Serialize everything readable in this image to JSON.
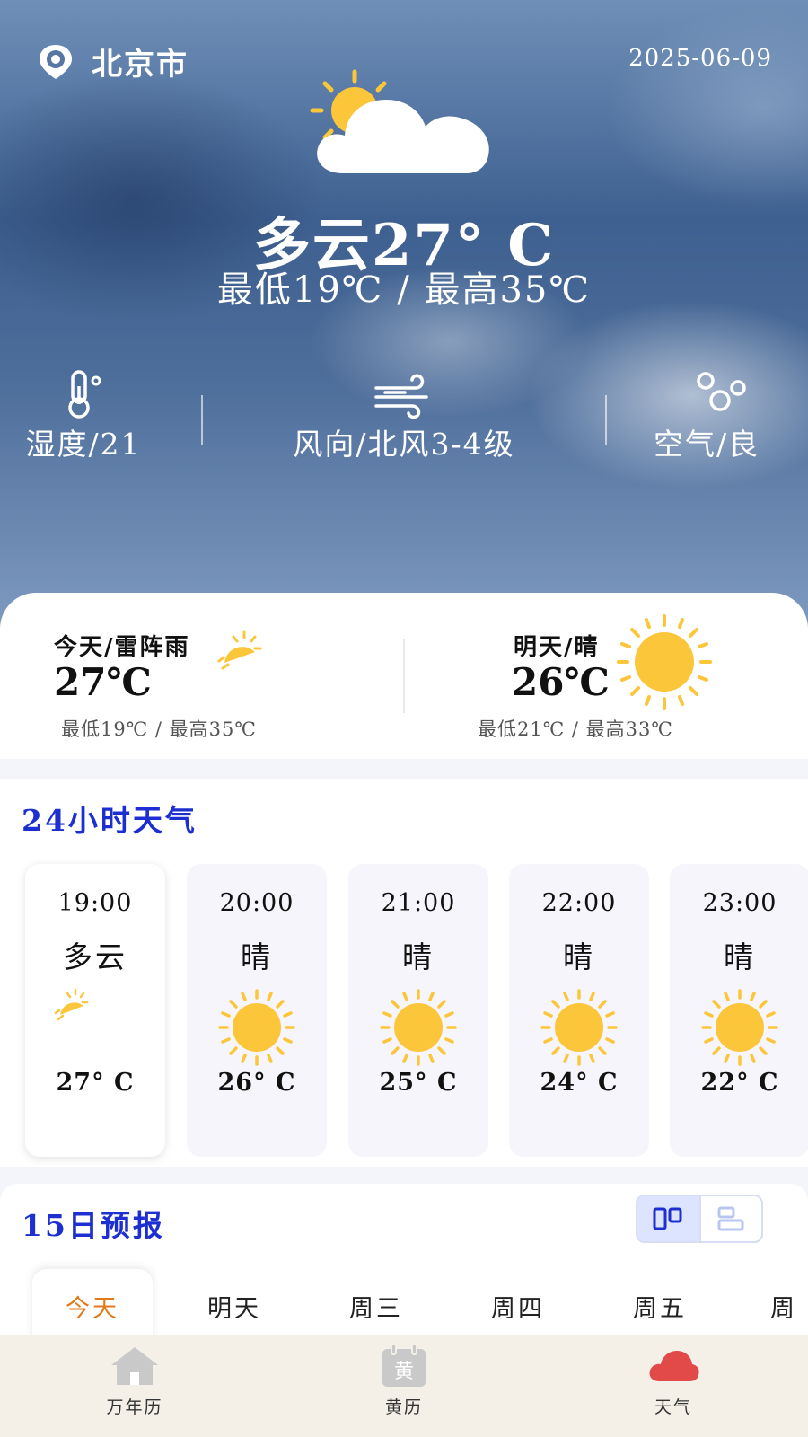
{
  "header": {
    "city": "北京市",
    "date": "2025-06-09",
    "condition_temp": "多云27° C",
    "range": "最低19℃  /  最高35℃"
  },
  "stats": [
    {
      "icon": "thermometer-icon",
      "label": "湿度/21"
    },
    {
      "icon": "wind-icon",
      "label": "风向/北风3-4级"
    },
    {
      "icon": "air-quality-icon",
      "label": "空气/良"
    }
  ],
  "summary": {
    "today": {
      "title": "今天/雷阵雨",
      "temp": "27℃",
      "range": "最低19℃ / 最高35℃",
      "icon": "partly-sunny-icon"
    },
    "tomorrow": {
      "title": "明天/晴",
      "temp": "26℃",
      "range": "最低21℃ / 最高33℃",
      "icon": "sun-icon"
    }
  },
  "hourly": {
    "title": "24小时天气",
    "items": [
      {
        "time": "19:00",
        "condition": "多云",
        "temp": "27° C",
        "icon": "partly-cloudy-icon"
      },
      {
        "time": "20:00",
        "condition": "晴",
        "temp": "26° C",
        "icon": "sun-icon"
      },
      {
        "time": "21:00",
        "condition": "晴",
        "temp": "25° C",
        "icon": "sun-icon"
      },
      {
        "time": "22:00",
        "condition": "晴",
        "temp": "24° C",
        "icon": "sun-icon"
      },
      {
        "time": "23:00",
        "condition": "晴",
        "temp": "22° C",
        "icon": "sun-icon"
      }
    ]
  },
  "forecast": {
    "title": "15日预报",
    "days": [
      "今天",
      "明天",
      "周三",
      "周四",
      "周五",
      "周"
    ]
  },
  "nav": [
    {
      "label": "万年历",
      "icon": "home-icon"
    },
    {
      "label": "黄历",
      "icon": "almanac-icon",
      "icon_char": "黄"
    },
    {
      "label": "天气",
      "icon": "cloud-icon"
    }
  ],
  "colors": {
    "accent_blue": "#1d2fd0",
    "sun_yellow": "#fcc63b",
    "active_tab": "#e07a1a",
    "nav_weather_red": "#e24a4a"
  }
}
